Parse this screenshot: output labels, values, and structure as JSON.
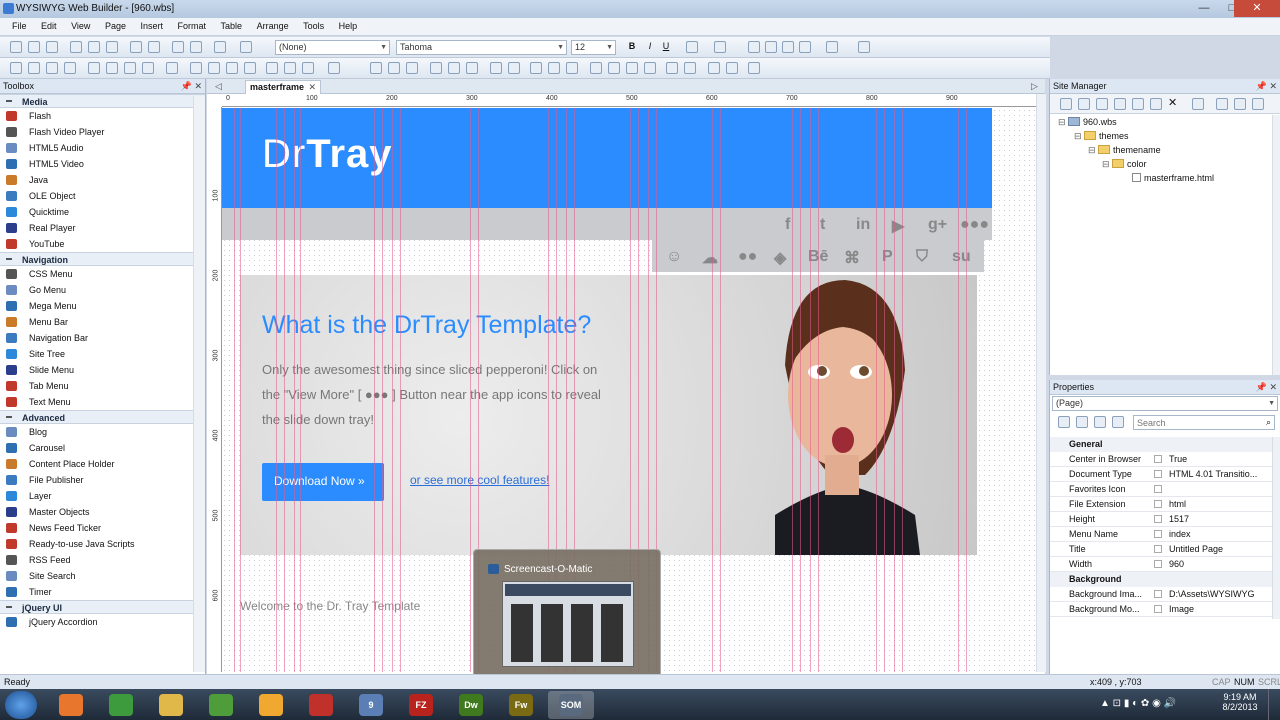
{
  "window": {
    "title": "WYSIWYG Web Builder - [960.wbs]",
    "minimize": "—",
    "maximize": "□",
    "close": "✕"
  },
  "menu": [
    "File",
    "Edit",
    "View",
    "Page",
    "Insert",
    "Format",
    "Table",
    "Arrange",
    "Tools",
    "Help"
  ],
  "format_bar": {
    "style_value": "(None)",
    "font_value": "Tahoma",
    "size_value": "12"
  },
  "toolbox": {
    "title": "Toolbox",
    "categories": [
      {
        "name": "Media",
        "items": [
          "Flash",
          "Flash Video Player",
          "HTML5 Audio",
          "HTML5 Video",
          "Java",
          "OLE Object",
          "Quicktime",
          "Real Player",
          "YouTube"
        ]
      },
      {
        "name": "Navigation",
        "items": [
          "CSS Menu",
          "Go Menu",
          "Mega Menu",
          "Menu Bar",
          "Navigation Bar",
          "Site Tree",
          "Slide Menu",
          "Tab Menu",
          "Text Menu"
        ]
      },
      {
        "name": "Advanced",
        "items": [
          "Blog",
          "Carousel",
          "Content Place Holder",
          "File Publisher",
          "Layer",
          "Master Objects",
          "News Feed Ticker",
          "Ready-to-use Java Scripts",
          "RSS Feed",
          "Site Search",
          "Timer"
        ]
      },
      {
        "name": "jQuery UI",
        "items": [
          "jQuery Accordion"
        ]
      }
    ]
  },
  "document": {
    "tab": "masterframe",
    "ruler_h": [
      "0",
      "100",
      "200",
      "300",
      "400",
      "500",
      "600",
      "700",
      "800",
      "900"
    ],
    "ruler_v": [
      "100",
      "200",
      "300",
      "400",
      "500",
      "600"
    ],
    "page": {
      "logo_light": "Dr",
      "logo_bold": "Tray",
      "hero_title": "What is the DrTray Template?",
      "hero_text": "Only the awesomest thing since sliced pepperoni! Click on the \"View More\" [ ●●● ] Button near the app icons to reveal the slide down tray!",
      "download_button": "Download Now »",
      "more_link": "or see more cool features!",
      "welcome": "Welcome to the Dr. Tray Template"
    }
  },
  "site_manager": {
    "title": "Site Manager",
    "tree": [
      "960.wbs",
      "themes",
      "themename",
      "color",
      "masterframe.html"
    ]
  },
  "properties": {
    "title": "Properties",
    "object": "(Page)",
    "search_placeholder": "Search",
    "groups": [
      {
        "name": "General",
        "rows": [
          {
            "key": "Center in Browser",
            "value": "True"
          },
          {
            "key": "Document Type",
            "value": "HTML 4.01 Transitio..."
          },
          {
            "key": "Favorites Icon",
            "value": ""
          },
          {
            "key": "File Extension",
            "value": "html"
          },
          {
            "key": "Height",
            "value": "1517"
          },
          {
            "key": "Menu Name",
            "value": "index"
          },
          {
            "key": "Title",
            "value": "Untitled Page"
          },
          {
            "key": "Width",
            "value": "960"
          }
        ]
      },
      {
        "name": "Background",
        "rows": [
          {
            "key": "Background Ima...",
            "value": "D:\\Assets\\WYSIWYG"
          },
          {
            "key": "Background Mo...",
            "value": "Image"
          }
        ]
      }
    ]
  },
  "popup": {
    "title": "Screencast-O-Matic"
  },
  "status": {
    "text": "Ready",
    "coords": "x:409 , y:703",
    "cap": "CAP",
    "num": "NUM",
    "scrl": "SCRL"
  },
  "taskbar": {
    "apps": [
      "Firefox",
      "Chrome",
      "Explorer",
      "Evernote",
      "User",
      "Acrobat",
      "WB 9",
      "FileZilla",
      "Dw",
      "Fw",
      "SOM"
    ],
    "time": "9:19 AM",
    "date": "8/2/2013"
  }
}
